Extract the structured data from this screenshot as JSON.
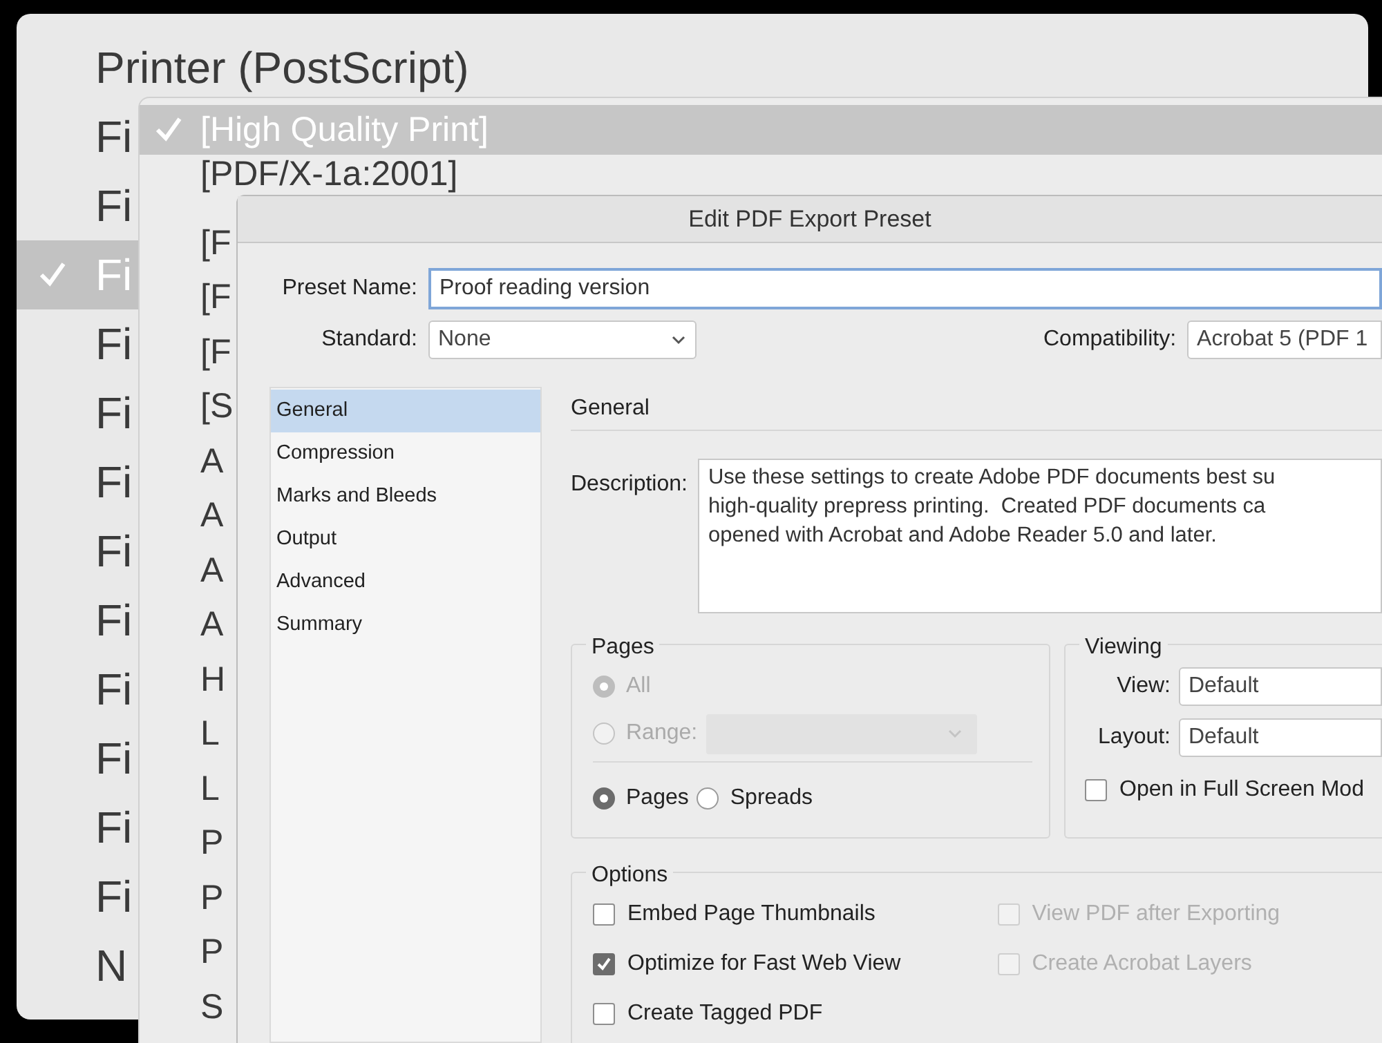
{
  "printer_menu": {
    "items": [
      {
        "label": "Printer (PostScript)",
        "selected": false
      },
      {
        "label": "Fi",
        "selected": false
      },
      {
        "label": "Fi",
        "selected": false
      },
      {
        "label": "Fi",
        "selected": true
      },
      {
        "label": "Fi",
        "selected": false
      },
      {
        "label": "Fi",
        "selected": false
      },
      {
        "label": "Fi",
        "selected": false
      },
      {
        "label": "Fi",
        "selected": false
      },
      {
        "label": "Fi",
        "selected": false
      },
      {
        "label": "Fi",
        "selected": false
      },
      {
        "label": "Fi",
        "selected": false
      },
      {
        "label": "Fi",
        "selected": false
      },
      {
        "label": "Fi",
        "selected": false
      },
      {
        "label": "N",
        "selected": false
      }
    ]
  },
  "preset_menu": {
    "items": [
      {
        "label": "[High Quality Print]",
        "selected": true
      },
      {
        "label": "[PDF/X-1a:2001]",
        "selected": false
      },
      {
        "label": "[F",
        "selected": false
      },
      {
        "label": "[F",
        "selected": false
      },
      {
        "label": "[F",
        "selected": false
      },
      {
        "label": "[S",
        "selected": false
      },
      {
        "label": "A",
        "selected": false
      },
      {
        "label": "A",
        "selected": false
      },
      {
        "label": "A",
        "selected": false
      },
      {
        "label": "A",
        "selected": false
      },
      {
        "label": "H",
        "selected": false
      },
      {
        "label": "L",
        "selected": false
      },
      {
        "label": "L",
        "selected": false
      },
      {
        "label": "P",
        "selected": false
      },
      {
        "label": "P",
        "selected": false
      },
      {
        "label": "P",
        "selected": false
      },
      {
        "label": "S",
        "selected": false
      }
    ]
  },
  "dialog": {
    "title": "Edit PDF Export Preset",
    "preset_name": {
      "label": "Preset Name:",
      "value": "Proof reading version"
    },
    "standard": {
      "label": "Standard:",
      "value": "None"
    },
    "compatibility": {
      "label": "Compatibility:",
      "value": "Acrobat 5 (PDF 1"
    },
    "sidebar": {
      "items": [
        {
          "label": "General",
          "selected": true
        },
        {
          "label": "Compression",
          "selected": false
        },
        {
          "label": "Marks and Bleeds",
          "selected": false
        },
        {
          "label": "Output",
          "selected": false
        },
        {
          "label": "Advanced",
          "selected": false
        },
        {
          "label": "Summary",
          "selected": false
        }
      ]
    },
    "section_title": "General",
    "description": {
      "label": "Description:",
      "value": "Use these settings to create Adobe PDF documents best su\nhigh-quality prepress printing.  Created PDF documents ca\nopened with Acrobat and Adobe Reader 5.0 and later."
    },
    "pages": {
      "title": "Pages",
      "range_options": [
        {
          "label": "All",
          "selected": true,
          "disabled": true
        },
        {
          "label": "Range:",
          "selected": false,
          "disabled": true
        }
      ],
      "layout_options": [
        {
          "label": "Pages",
          "selected": true
        },
        {
          "label": "Spreads",
          "selected": false
        }
      ]
    },
    "viewing": {
      "title": "Viewing",
      "view": {
        "label": "View:",
        "value": "Default"
      },
      "layout": {
        "label": "Layout:",
        "value": "Default"
      },
      "full_screen": {
        "label": "Open in Full Screen Mod",
        "checked": false
      }
    },
    "options": {
      "title": "Options",
      "left": [
        {
          "label": "Embed Page Thumbnails",
          "checked": false,
          "disabled": false
        },
        {
          "label": "Optimize for Fast Web View",
          "checked": true,
          "disabled": false
        },
        {
          "label": "Create Tagged PDF",
          "checked": false,
          "disabled": false
        }
      ],
      "right": [
        {
          "label": "View PDF after Exporting",
          "checked": false,
          "disabled": true
        },
        {
          "label": "Create Acrobat Layers",
          "checked": false,
          "disabled": true
        }
      ]
    }
  }
}
